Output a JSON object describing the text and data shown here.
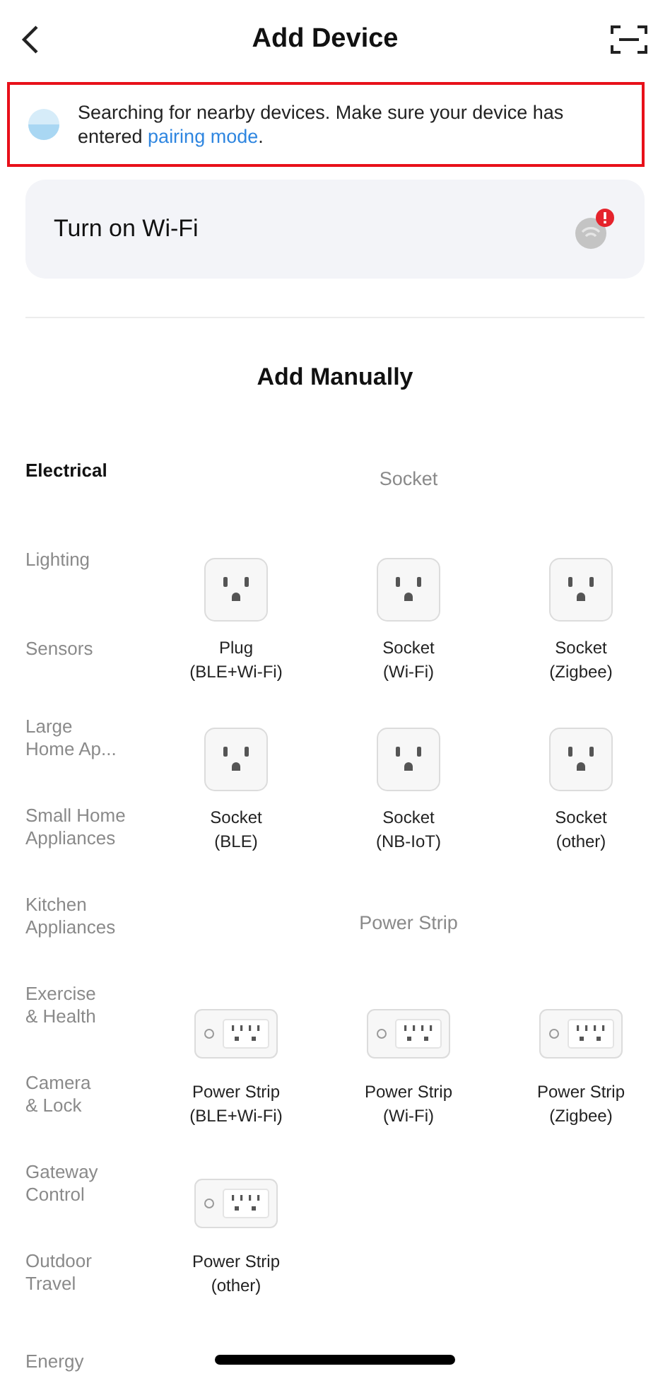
{
  "header": {
    "title": "Add Device"
  },
  "banner": {
    "text": "Searching for nearby devices. Make sure your device has entered ",
    "link": "pairing mode",
    "text_after": ".",
    "highlighted": true
  },
  "wifi_card": {
    "label": "Turn on Wi-Fi",
    "alert": true
  },
  "section_title": "Add Manually",
  "categories": [
    {
      "label": "Electrical",
      "selected": true
    },
    {
      "label": "Lighting",
      "selected": false
    },
    {
      "label": "Sensors",
      "selected": false
    },
    {
      "label": "Large\nHome Ap...",
      "selected": false
    },
    {
      "label": "Small Home\nAppliances",
      "selected": false
    },
    {
      "label": "Kitchen\nAppliances",
      "selected": false
    },
    {
      "label": "Exercise\n& Health",
      "selected": false
    },
    {
      "label": "Camera\n& Lock",
      "selected": false
    },
    {
      "label": "Gateway\nControl",
      "selected": false
    },
    {
      "label": "Outdoor\nTravel",
      "selected": false
    },
    {
      "label": "Energy",
      "selected": false
    }
  ],
  "groups": [
    {
      "title": "Socket",
      "devices": [
        {
          "kind": "socket",
          "name": "Plug",
          "variant": "(BLE+Wi-Fi)"
        },
        {
          "kind": "socket",
          "name": "Socket",
          "variant": "(Wi-Fi)"
        },
        {
          "kind": "socket",
          "name": "Socket",
          "variant": "(Zigbee)"
        },
        {
          "kind": "socket",
          "name": "Socket",
          "variant": "(BLE)"
        },
        {
          "kind": "socket",
          "name": "Socket",
          "variant": "(NB-IoT)"
        },
        {
          "kind": "socket",
          "name": "Socket",
          "variant": "(other)"
        }
      ]
    },
    {
      "title": "Power Strip",
      "devices": [
        {
          "kind": "strip",
          "name": "Power Strip",
          "variant": "(BLE+Wi-Fi)"
        },
        {
          "kind": "strip",
          "name": "Power Strip",
          "variant": "(Wi-Fi)"
        },
        {
          "kind": "strip",
          "name": "Power Strip",
          "variant": "(Zigbee)"
        },
        {
          "kind": "strip",
          "name": "Power Strip",
          "variant": "(other)"
        }
      ]
    }
  ]
}
